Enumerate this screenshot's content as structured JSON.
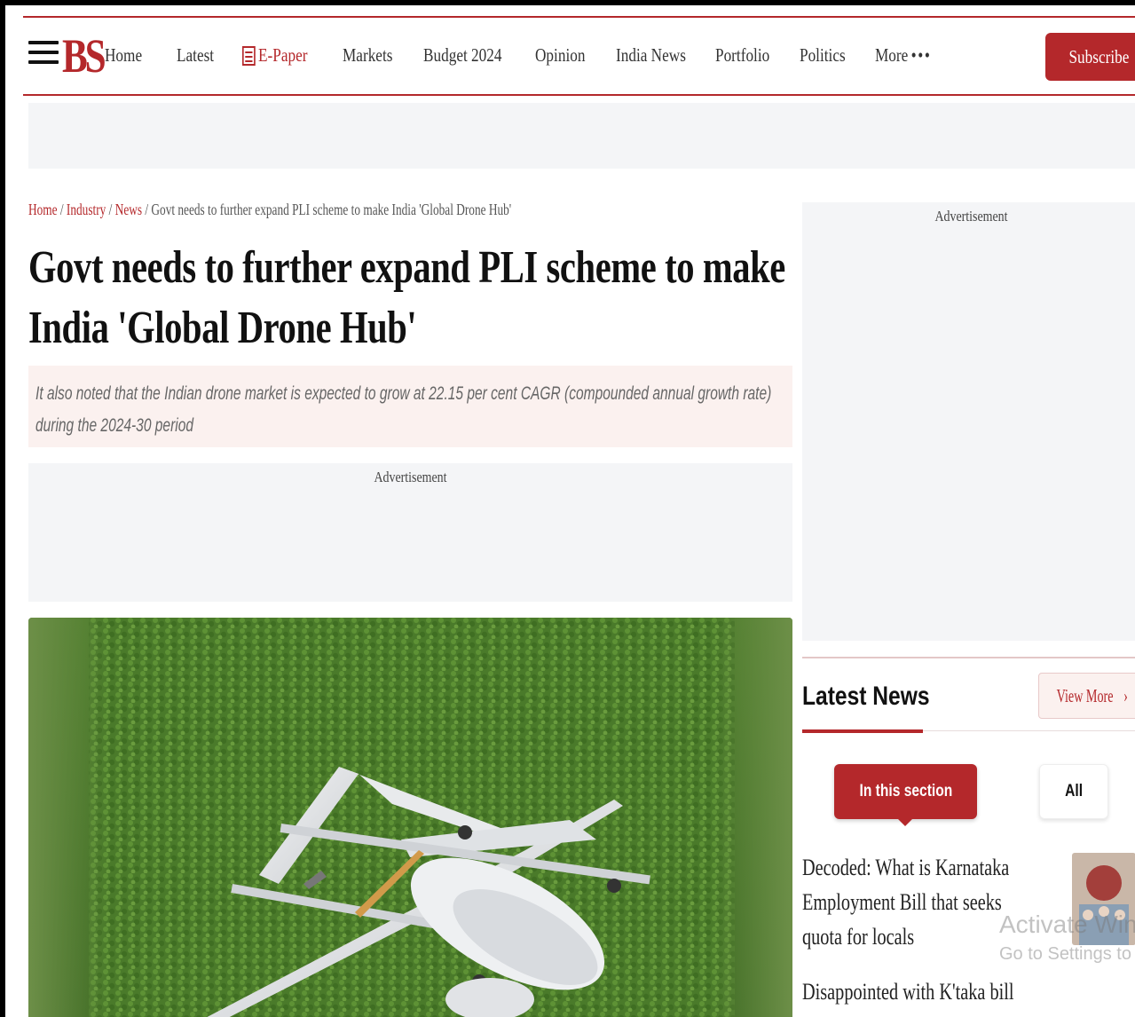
{
  "header": {
    "logo": "BS",
    "nav": [
      "Home",
      "Latest",
      "E-Paper",
      "Markets",
      "Budget 2024",
      "Opinion",
      "India News",
      "Portfolio",
      "Politics",
      "More"
    ],
    "subscribe_label": "Subscribe"
  },
  "breadcrumb": {
    "items": [
      "Home",
      "Industry",
      "News"
    ],
    "current": "Govt needs to further expand PLI scheme to make India 'Global Drone Hub'",
    "separator": "/"
  },
  "article": {
    "headline": "Govt needs to further expand PLI scheme to make India 'Global Drone Hub'",
    "summary": "It also noted that the Indian drone market is expected to grow at 22.15 per cent CAGR (compounded annual growth rate) during the 2024-30 period",
    "ad_label": "Advertisement"
  },
  "sidebar": {
    "ad_label": "Advertisement",
    "latest_news_title": "Latest News",
    "view_more_label": "View More",
    "tabs": [
      "In this section",
      "All"
    ],
    "news": [
      {
        "title": "Decoded: What is Karnataka Employment Bill that seeks quota for locals"
      },
      {
        "title": "Disappointed with K'taka bill"
      }
    ]
  },
  "overlay": {
    "watermark_line1": "Activate Windows",
    "watermark_line2": "Go to Settings to activate Windows."
  },
  "colors": {
    "brand_red": "#b4282b",
    "summary_bg": "#fbf1ef",
    "ad_bg": "#f4f5f7"
  }
}
